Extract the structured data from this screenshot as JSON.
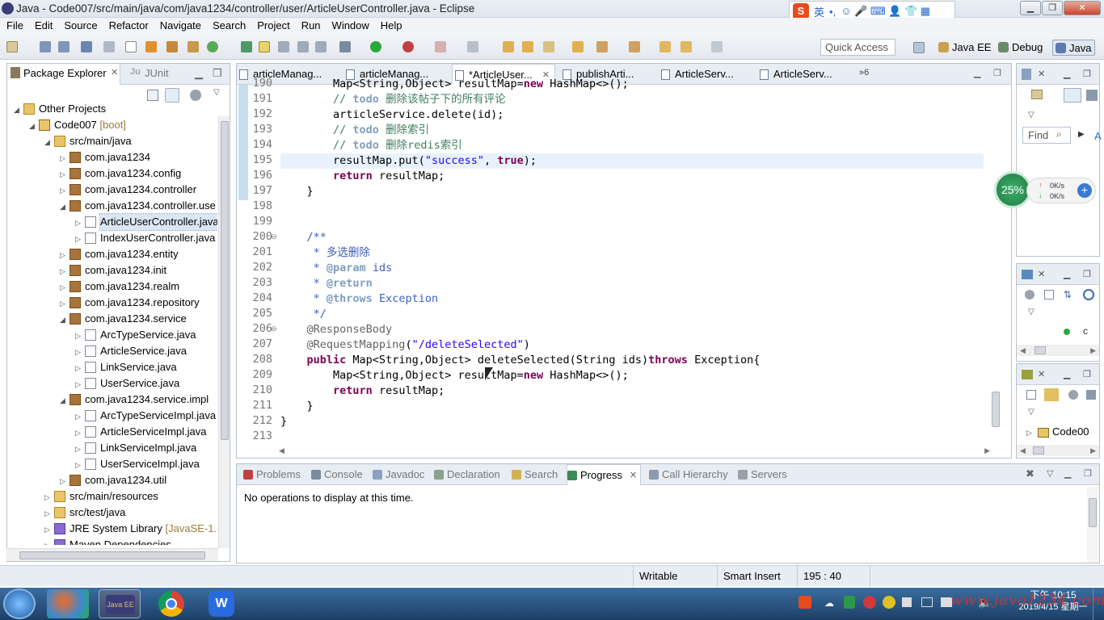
{
  "window": {
    "title": "Java - Code007/src/main/java/com/java1234/controller/user/ArticleUserController.java - Eclipse",
    "min": "▁",
    "max": "❐",
    "close": "✕"
  },
  "ime": {
    "logo": "S",
    "lang": "英",
    "punct": "•,",
    "icons": "☺ 🎤 ⌨ 👤 👕 ▦"
  },
  "menu": [
    "File",
    "Edit",
    "Source",
    "Refactor",
    "Navigate",
    "Search",
    "Project",
    "Run",
    "Window",
    "Help"
  ],
  "toolbar": {
    "quick_access": "Quick Access",
    "perspectives": [
      "Java EE",
      "Debug",
      "Java"
    ]
  },
  "package_explorer": {
    "tabs": [
      "Package Explorer",
      "JUnit"
    ],
    "tree": [
      {
        "indent": 0,
        "tw": "◢",
        "icon": "folder",
        "label": "Other Projects",
        "dec": ""
      },
      {
        "indent": 1,
        "tw": "◢",
        "icon": "proj",
        "label": "Code007",
        "dec": " [boot]"
      },
      {
        "indent": 2,
        "tw": "◢",
        "icon": "folder",
        "label": "src/main/java",
        "dec": ""
      },
      {
        "indent": 3,
        "tw": "▷",
        "icon": "pkg",
        "label": "com.java1234",
        "dec": ""
      },
      {
        "indent": 3,
        "tw": "▷",
        "icon": "pkg",
        "label": "com.java1234.config",
        "dec": ""
      },
      {
        "indent": 3,
        "tw": "▷",
        "icon": "pkg",
        "label": "com.java1234.controller",
        "dec": ""
      },
      {
        "indent": 3,
        "tw": "◢",
        "icon": "pkg",
        "label": "com.java1234.controller.use",
        "dec": ""
      },
      {
        "indent": 4,
        "tw": "▷",
        "icon": "java",
        "label": "ArticleUserController.java",
        "dec": "",
        "selected": true
      },
      {
        "indent": 4,
        "tw": "▷",
        "icon": "java",
        "label": "IndexUserController.java",
        "dec": ""
      },
      {
        "indent": 3,
        "tw": "▷",
        "icon": "pkg",
        "label": "com.java1234.entity",
        "dec": ""
      },
      {
        "indent": 3,
        "tw": "▷",
        "icon": "pkg",
        "label": "com.java1234.init",
        "dec": ""
      },
      {
        "indent": 3,
        "tw": "▷",
        "icon": "pkg",
        "label": "com.java1234.realm",
        "dec": ""
      },
      {
        "indent": 3,
        "tw": "▷",
        "icon": "pkg",
        "label": "com.java1234.repository",
        "dec": ""
      },
      {
        "indent": 3,
        "tw": "◢",
        "icon": "pkg",
        "label": "com.java1234.service",
        "dec": ""
      },
      {
        "indent": 4,
        "tw": "▷",
        "icon": "java",
        "label": "ArcTypeService.java",
        "dec": ""
      },
      {
        "indent": 4,
        "tw": "▷",
        "icon": "java",
        "label": "ArticleService.java",
        "dec": ""
      },
      {
        "indent": 4,
        "tw": "▷",
        "icon": "java",
        "label": "LinkService.java",
        "dec": ""
      },
      {
        "indent": 4,
        "tw": "▷",
        "icon": "java",
        "label": "UserService.java",
        "dec": ""
      },
      {
        "indent": 3,
        "tw": "◢",
        "icon": "pkg",
        "label": "com.java1234.service.impl",
        "dec": ""
      },
      {
        "indent": 4,
        "tw": "▷",
        "icon": "java",
        "label": "ArcTypeServiceImpl.java",
        "dec": ""
      },
      {
        "indent": 4,
        "tw": "▷",
        "icon": "java",
        "label": "ArticleServiceImpl.java",
        "dec": ""
      },
      {
        "indent": 4,
        "tw": "▷",
        "icon": "java",
        "label": "LinkServiceImpl.java",
        "dec": ""
      },
      {
        "indent": 4,
        "tw": "▷",
        "icon": "java",
        "label": "UserServiceImpl.java",
        "dec": ""
      },
      {
        "indent": 3,
        "tw": "▷",
        "icon": "pkg",
        "label": "com.java1234.util",
        "dec": ""
      },
      {
        "indent": 2,
        "tw": "▷",
        "icon": "folder",
        "label": "src/main/resources",
        "dec": ""
      },
      {
        "indent": 2,
        "tw": "▷",
        "icon": "folder",
        "label": "src/test/java",
        "dec": ""
      },
      {
        "indent": 2,
        "tw": "▷",
        "icon": "jar",
        "label": "JRE System Library",
        "dec": " [JavaSE-1.8]"
      },
      {
        "indent": 2,
        "tw": "▷",
        "icon": "jar",
        "label": "Maven Dependencies",
        "dec": ""
      }
    ]
  },
  "editor": {
    "tabs": [
      "articleManag...",
      "articleManag...",
      "*ArticleUser...",
      "publishArti...",
      "ArticleServ...",
      "ArticleServ..."
    ],
    "active_tab": 2,
    "overflow": "»6",
    "lines": [
      {
        "n": "190",
        "html": "        Map&lt;String,Object&gt; resultMap=<span class='kw'>new</span> HashMap&lt;&gt;();"
      },
      {
        "n": "191",
        "html": "        <span class='cm'>// <span class='td'>todo</span> 删除该帖子下的所有评论</span>"
      },
      {
        "n": "192",
        "html": "        articleService.delete(id);"
      },
      {
        "n": "193",
        "html": "        <span class='cm'>// <span class='td'>todo</span> 删除索引</span>"
      },
      {
        "n": "194",
        "html": "        <span class='cm'>// <span class='td'>todo</span> 删除redis索引</span>"
      },
      {
        "n": "195",
        "html": "        resultMap.put(<span class='st'>\"success\"</span>, <span class='kw'>true</span>);",
        "current": true
      },
      {
        "n": "196",
        "html": "        <span class='kw'>return</span> resultMap;"
      },
      {
        "n": "197",
        "html": "    }"
      },
      {
        "n": "198",
        "html": ""
      },
      {
        "n": "199",
        "html": ""
      },
      {
        "n": "200",
        "html": "    <span class='jd'>/**</span>",
        "fold": true
      },
      {
        "n": "201",
        "html": "     <span class='jd'>* 多选删除</span>"
      },
      {
        "n": "202",
        "html": "     <span class='jd'>* <span class='jt'>@param</span> ids</span>"
      },
      {
        "n": "203",
        "html": "     <span class='jd'>* <span class='jt'>@return</span></span>"
      },
      {
        "n": "204",
        "html": "     <span class='jd'>* <span class='jt'>@throws</span> Exception</span>"
      },
      {
        "n": "205",
        "html": "     <span class='jd'>*/</span>"
      },
      {
        "n": "206",
        "html": "    <span class='an'>@ResponseBody</span>",
        "fold": true
      },
      {
        "n": "207",
        "html": "    <span class='an'>@RequestMapping</span>(<span class='st'>\"/deleteSelected\"</span>)"
      },
      {
        "n": "208",
        "html": "    <span class='kw'>public</span> Map&lt;String,Object&gt; deleteSelected(String ids)<span class='kw'>throws</span> Exception{"
      },
      {
        "n": "209",
        "html": "        Map&lt;String,Object&gt; resultMap=<span class='kw'>new</span> HashMap&lt;&gt;();"
      },
      {
        "n": "210",
        "html": "        <span class='kw'>return</span> resultMap;"
      },
      {
        "n": "211",
        "html": "    }"
      },
      {
        "n": "212",
        "html": "}"
      },
      {
        "n": "213",
        "html": ""
      }
    ]
  },
  "right_panel": {
    "find_placeholder": "Find",
    "net_percent": "25%",
    "up": "0K/s",
    "down": "0K/s",
    "tree_item": "Code00"
  },
  "console": {
    "tabs": [
      "Problems",
      "Console",
      "Javadoc",
      "Declaration",
      "Search",
      "Progress",
      "Call Hierarchy",
      "Servers"
    ],
    "active_tab": 5,
    "message": "No operations to display at this time."
  },
  "status": {
    "writable": "Writable",
    "insert_mode": "Smart Insert",
    "position": "195 : 40"
  },
  "taskbar": {
    "time": "下午 10:15",
    "date": "2019/4/15 星期一",
    "watermark": "www.java1234.com",
    "apps": [
      "start",
      "media",
      "java-ee-ide",
      "chrome",
      "wps"
    ]
  },
  "colors": {
    "keyword": "#7f0055",
    "comment": "#3f7f5f",
    "string": "#2a00ff",
    "javadoc": "#3f5fbf"
  }
}
